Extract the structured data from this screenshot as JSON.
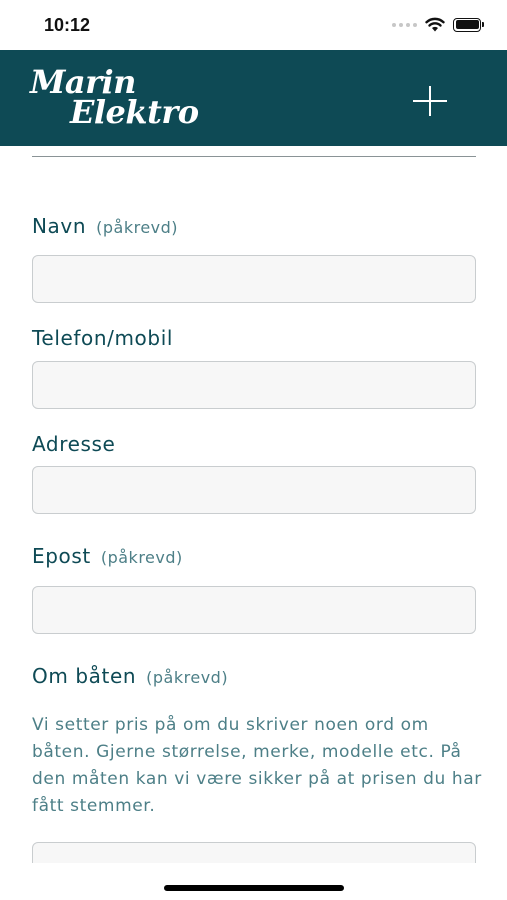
{
  "status_bar": {
    "time": "10:12",
    "icons": [
      "signal-dots-icon",
      "wifi-icon",
      "battery-icon"
    ]
  },
  "header": {
    "logo_line1": "Marin",
    "logo_line2": "Elektro",
    "menu_icon": "plus-icon",
    "background_color": "#0e4a55"
  },
  "form": {
    "required_text": "(påkrevd)",
    "fields": {
      "name": {
        "label": "Navn",
        "value": ""
      },
      "phone": {
        "label": "Telefon/mobil",
        "value": ""
      },
      "address": {
        "label": "Adresse",
        "value": ""
      },
      "email": {
        "label": "Epost",
        "value": ""
      },
      "boat": {
        "label": "Om båten",
        "help": "Vi setter pris på om du skriver noen ord om båten. Gjerne størrelse, merke, modelle etc. På den måten kan vi være sikker på at prisen du har fått stemmer.",
        "value": ""
      }
    }
  },
  "colors": {
    "accent": "#0e4a55",
    "muted_text": "#4d7f87",
    "input_border": "#c9cdcf",
    "input_background": "#f7f7f7"
  }
}
